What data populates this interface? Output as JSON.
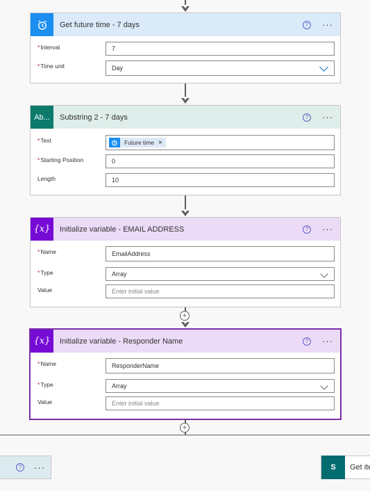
{
  "colors": {
    "time_accent": "#1b8ef0",
    "time_header": "#dbebfa",
    "text_accent": "#0d7b6c",
    "text_header": "#dfeeea",
    "variable_accent": "#770bd6",
    "variable_header": "#ecdbf7",
    "required": "#a4262c"
  },
  "cards": [
    {
      "title": "Get future time - 7 days",
      "icon": "alarm-clock-icon",
      "fields": [
        {
          "label": "Interval",
          "required": true,
          "value": "7"
        },
        {
          "label": "Time unit",
          "required": true,
          "value": "Day"
        }
      ]
    },
    {
      "title": "Substring 2 - 7 days",
      "icon_text": "Ab...",
      "fields": [
        {
          "label": "Text",
          "required": true,
          "token": "Future time"
        },
        {
          "label": "Starting Position",
          "required": true,
          "value": "0"
        },
        {
          "label": "Length",
          "required": false,
          "value": "10"
        }
      ]
    },
    {
      "title": "Initialize variable - EMAIL ADDRESS",
      "icon_text": "{x}",
      "fields": [
        {
          "label": "Name",
          "required": true,
          "value": "EmailAddress"
        },
        {
          "label": "Type",
          "required": true,
          "value": "Array"
        },
        {
          "label": "Value",
          "required": false,
          "placeholder": "Enter initial value"
        }
      ]
    },
    {
      "title": "Initialize variable - Responder Name",
      "icon_text": "{x}",
      "fields": [
        {
          "label": "Name",
          "required": true,
          "value": "ResponderName"
        },
        {
          "label": "Type",
          "required": true,
          "value": "Array"
        },
        {
          "label": "Value",
          "required": false,
          "placeholder": "Enter initial value"
        }
      ]
    }
  ],
  "common": {
    "required_mark": "*",
    "help_glyph": "?",
    "more_glyph": "···",
    "plus_glyph": "+",
    "close_glyph": "×"
  },
  "bottom": {
    "right_card_label": "Get ite",
    "sp_icon_text": "S"
  }
}
